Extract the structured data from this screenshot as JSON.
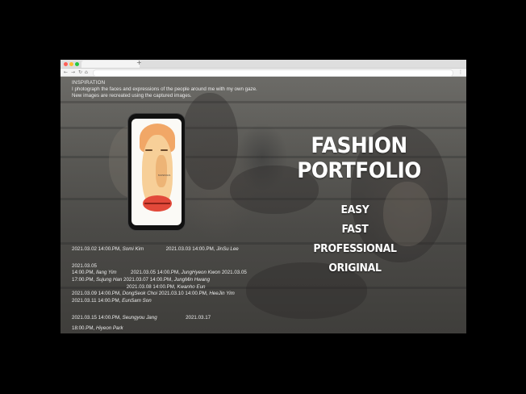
{
  "browser": {
    "new_tab_symbol": "+",
    "back_symbol": "←",
    "forward_symbol": "→",
    "reload_symbol": "↻",
    "home_symbol": "⌂",
    "menu_symbol": "⋮"
  },
  "inspiration": {
    "title": "INSPIRATION",
    "line1": "I photograph the faces and expressions of the people around me with my own gaze.",
    "line2": "New images are recreated using the captured images."
  },
  "phone": {
    "screen_tag": "MUSINGS"
  },
  "headline": {
    "line1": "FASHION",
    "line2": "PORTFOLIO"
  },
  "features": [
    "EASY",
    "FAST",
    "PROFESSIONAL",
    "ORIGINAL"
  ],
  "schedule": {
    "r1a_time": "2021.03.02 14:00.PM,",
    "r1a_name": "Somi Kim",
    "r1b_time": "2021.03.03 14:00.PM,",
    "r1b_name": "JinSu Lee",
    "r2_date": "2021.03.05",
    "r3a_time": "14:00.PM,",
    "r3a_name": "Ilang Yim",
    "r3b_time": "2021.03.05 14:00.PM,",
    "r3b_name": "JungHyeon Kwon",
    "r3c_time": "2021.03.05",
    "r4a_time": "17:00.PM,",
    "r4a_name": "Sujung Han",
    "r4b_time": "2021.03.07 14:00.PM,",
    "r4b_name": "JungMin Hwang",
    "r5_time": "2021.03.08 14:00.PM,",
    "r5_name": "Kwanho Eun",
    "r6a_time": "2021.03.09 14:00.PM,",
    "r6a_name": "DongSeok Choi",
    "r6b_time": "2021.03.10 14:00.PM,",
    "r6b_name": "HeeJin Yim",
    "r7_time": "2021.03.11 14:00.PM,",
    "r7_name": "EunSam Son",
    "r8a_time": "2021.03.15 14:00.PM,",
    "r8a_name": "Seungyou Jang",
    "r8b_time": "2021.03.17",
    "r9_time": "18:00.PM,",
    "r9_name": "Hiyeon Park"
  },
  "colors": {
    "background": "#000000",
    "text": "#ffffff",
    "lips": "#e2493a",
    "hair": "#f0a25f"
  },
  "icons": [
    "close-dot",
    "minimize-dot",
    "maximize-dot",
    "back-arrow-icon",
    "forward-arrow-icon",
    "reload-icon",
    "home-icon",
    "menu-icon"
  ]
}
